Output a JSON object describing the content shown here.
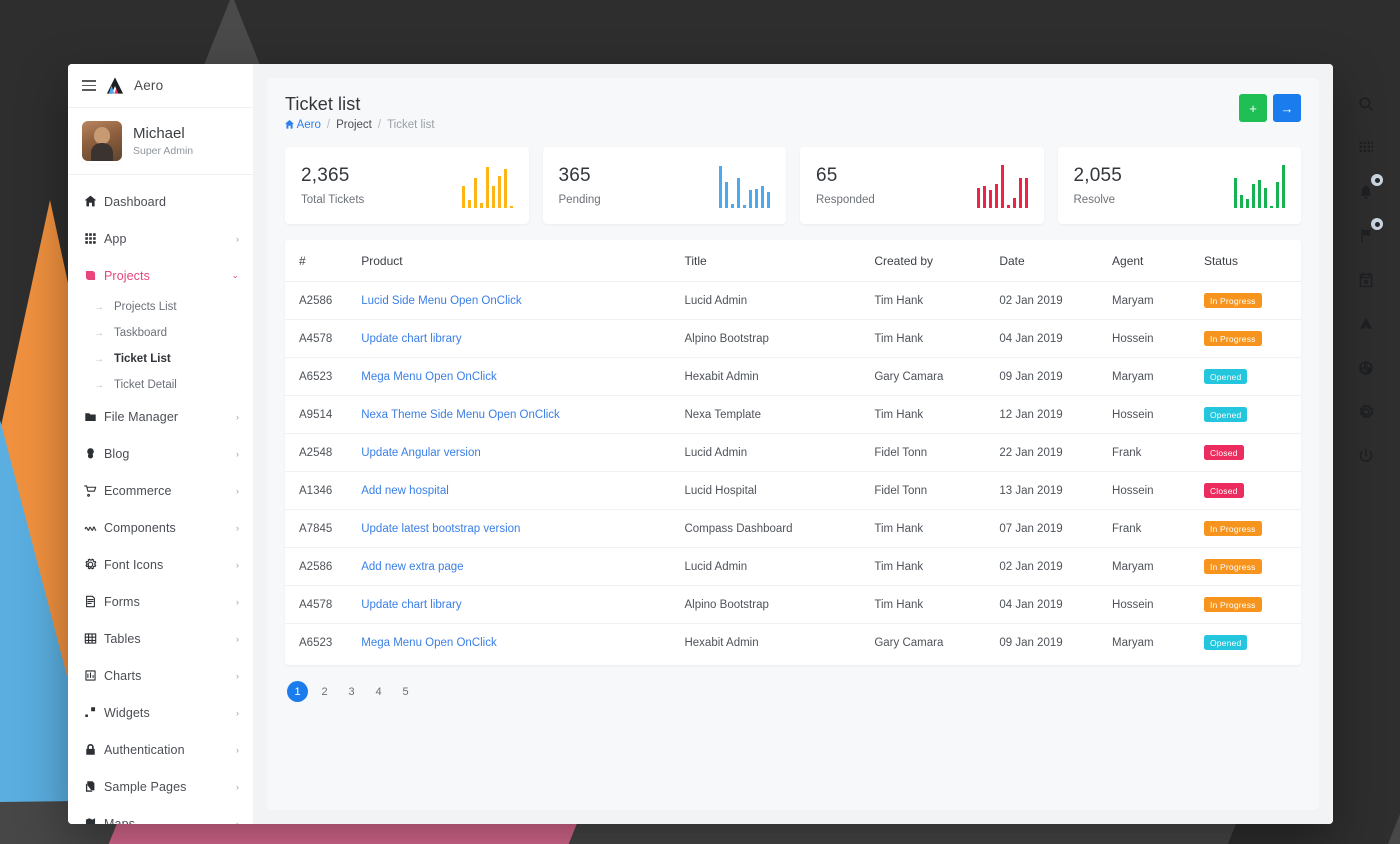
{
  "brand": {
    "name": "Aero",
    "logo_icon": "aero-triangle-logo",
    "menu_icon": "hamburger-icon"
  },
  "user": {
    "name": "Michael",
    "role": "Super Admin",
    "avatar_icon": "user-avatar"
  },
  "sidebar": {
    "items": [
      {
        "label": "Dashboard",
        "icon": "home-icon",
        "caret": "",
        "active": false
      },
      {
        "label": "App",
        "icon": "apps-icon",
        "caret": "›",
        "active": false
      },
      {
        "label": "Projects",
        "icon": "projects-icon",
        "caret": "⌄",
        "active": true
      },
      {
        "label": "File Manager",
        "icon": "folder-icon",
        "caret": "›",
        "active": false
      },
      {
        "label": "Blog",
        "icon": "blog-icon",
        "caret": "›",
        "active": false
      },
      {
        "label": "Ecommerce",
        "icon": "cart-icon",
        "caret": "›",
        "active": false
      },
      {
        "label": "Components",
        "icon": "components-icon",
        "caret": "›",
        "active": false
      },
      {
        "label": "Font Icons",
        "icon": "gear-icon",
        "caret": "›",
        "active": false
      },
      {
        "label": "Forms",
        "icon": "forms-icon",
        "caret": "›",
        "active": false
      },
      {
        "label": "Tables",
        "icon": "table-icon",
        "caret": "›",
        "active": false
      },
      {
        "label": "Charts",
        "icon": "chart-icon",
        "caret": "›",
        "active": false
      },
      {
        "label": "Widgets",
        "icon": "widgets-icon",
        "caret": "›",
        "active": false
      },
      {
        "label": "Authentication",
        "icon": "lock-icon",
        "caret": "›",
        "active": false
      },
      {
        "label": "Sample Pages",
        "icon": "pages-icon",
        "caret": "›",
        "active": false
      },
      {
        "label": "Maps",
        "icon": "map-icon",
        "caret": "›",
        "active": false
      }
    ],
    "subitems": [
      {
        "label": "Projects List",
        "current": false
      },
      {
        "label": "Taskboard",
        "current": false
      },
      {
        "label": "Ticket List",
        "current": true
      },
      {
        "label": "Ticket Detail",
        "current": false
      }
    ],
    "sub_arrow": "→"
  },
  "header": {
    "title": "Ticket list",
    "breadcrumb": {
      "home": "Aero",
      "middle": "Project",
      "current": "Ticket list",
      "separator": "/"
    },
    "actions": [
      {
        "name": "add-button",
        "icon": "plus-icon",
        "glyph": "+",
        "color": "#20bf55"
      },
      {
        "name": "next-button",
        "icon": "arrow-right-icon",
        "glyph": "→",
        "color": "#1a7ced"
      }
    ]
  },
  "stats": [
    {
      "value": "2,365",
      "label": "Total Tickets",
      "color": "#fcb416",
      "bars": [
        22,
        8,
        30,
        5,
        41,
        22,
        32,
        39,
        2
      ]
    },
    {
      "value": "365",
      "label": "Pending",
      "color": "#4aaaf0",
      "bars": [
        42,
        26,
        4,
        30,
        3,
        18,
        19,
        22,
        16
      ]
    },
    {
      "value": "65",
      "label": "Responded",
      "color": "#ee2345",
      "bars": [
        20,
        22,
        18,
        24,
        43,
        3,
        10,
        30,
        30
      ]
    },
    {
      "value": "2,055",
      "label": "Resolve",
      "color": "#18b252",
      "bars": [
        30,
        13,
        9,
        24,
        28,
        20,
        2,
        26,
        43
      ]
    }
  ],
  "table": {
    "columns": [
      "#",
      "Product",
      "Title",
      "Created by",
      "Date",
      "Agent",
      "Status"
    ],
    "rows": [
      {
        "id": "A2586",
        "product": "Lucid Side Menu Open OnClick",
        "title": "Lucid Admin",
        "created_by": "Tim Hank",
        "date": "02 Jan 2019",
        "agent": "Maryam",
        "status": "In Progress",
        "status_class": "b-progress"
      },
      {
        "id": "A4578",
        "product": "Update chart library",
        "title": "Alpino Bootstrap",
        "created_by": "Tim Hank",
        "date": "04 Jan 2019",
        "agent": "Hossein",
        "status": "In Progress",
        "status_class": "b-progress"
      },
      {
        "id": "A6523",
        "product": "Mega Menu Open OnClick",
        "title": "Hexabit Admin",
        "created_by": "Gary Camara",
        "date": "09 Jan 2019",
        "agent": "Maryam",
        "status": "Opened",
        "status_class": "b-opened"
      },
      {
        "id": "A9514",
        "product": "Nexa Theme Side Menu Open OnClick",
        "title": "Nexa Template",
        "created_by": "Tim Hank",
        "date": "12 Jan 2019",
        "agent": "Hossein",
        "status": "Opened",
        "status_class": "b-opened"
      },
      {
        "id": "A2548",
        "product": "Update Angular version",
        "title": "Lucid Admin",
        "created_by": "Fidel Tonn",
        "date": "22 Jan 2019",
        "agent": "Frank",
        "status": "Closed",
        "status_class": "b-closed"
      },
      {
        "id": "A1346",
        "product": "Add new hospital",
        "title": "Lucid Hospital",
        "created_by": "Fidel Tonn",
        "date": "13 Jan 2019",
        "agent": "Hossein",
        "status": "Closed",
        "status_class": "b-closed"
      },
      {
        "id": "A7845",
        "product": "Update latest bootstrap version",
        "title": "Compass Dashboard",
        "created_by": "Tim Hank",
        "date": "07 Jan 2019",
        "agent": "Frank",
        "status": "In Progress",
        "status_class": "b-progress"
      },
      {
        "id": "A2586",
        "product": "Add new extra page",
        "title": "Lucid Admin",
        "created_by": "Tim Hank",
        "date": "02 Jan 2019",
        "agent": "Maryam",
        "status": "In Progress",
        "status_class": "b-progress"
      },
      {
        "id": "A4578",
        "product": "Update chart library",
        "title": "Alpino Bootstrap",
        "created_by": "Tim Hank",
        "date": "04 Jan 2019",
        "agent": "Hossein",
        "status": "In Progress",
        "status_class": "b-progress"
      },
      {
        "id": "A6523",
        "product": "Mega Menu Open OnClick",
        "title": "Hexabit Admin",
        "created_by": "Gary Camara",
        "date": "09 Jan 2019",
        "agent": "Maryam",
        "status": "Opened",
        "status_class": "b-opened"
      }
    ]
  },
  "pagination": {
    "pages": [
      "1",
      "2",
      "3",
      "4",
      "5"
    ],
    "active": "1"
  },
  "rail": [
    {
      "icon": "search-icon",
      "badge": false
    },
    {
      "icon": "grid-apps-icon",
      "badge": false
    },
    {
      "icon": "bell-icon",
      "badge": true
    },
    {
      "icon": "flag-icon",
      "badge": true
    },
    {
      "icon": "calendar-icon",
      "badge": false
    },
    {
      "icon": "drive-icon",
      "badge": false
    },
    {
      "icon": "globe-icon",
      "badge": false
    },
    {
      "icon": "gear-icon",
      "badge": false
    },
    {
      "icon": "power-icon",
      "badge": false
    }
  ],
  "colors": {
    "accent_blue": "#1a7ced",
    "accent_green": "#20bf55",
    "active_pink": "#e8467c",
    "badge_progress": "#f7941d",
    "badge_opened": "#23c6dc",
    "badge_closed": "#ec2b5e"
  }
}
